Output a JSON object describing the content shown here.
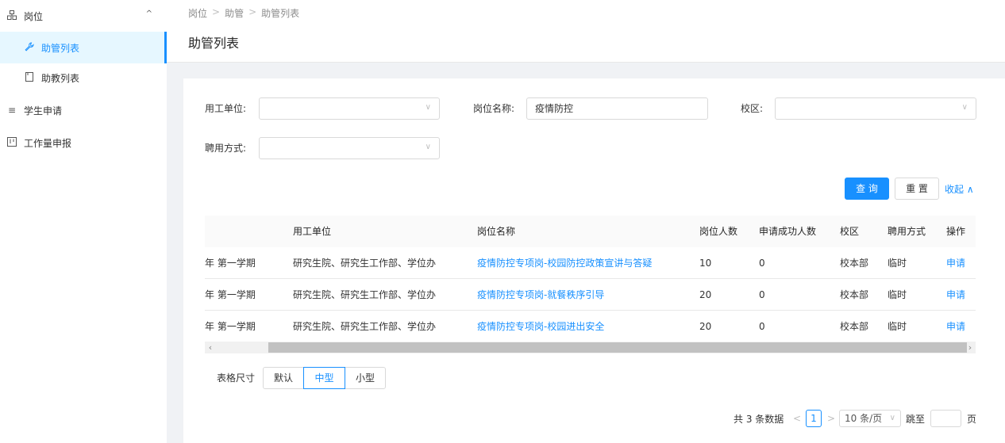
{
  "sidebar": {
    "items": [
      {
        "label": "岗位",
        "icon": "grid-icon",
        "expanded": true
      },
      {
        "label": "助管列表",
        "icon": "wrench-icon",
        "active": true
      },
      {
        "label": "助教列表",
        "icon": "document-icon"
      },
      {
        "label": "学生申请",
        "icon": "list-icon"
      },
      {
        "label": "工作量申报",
        "icon": "board-icon"
      }
    ]
  },
  "header": {
    "breadcrumb": [
      "岗位",
      "助管",
      "助管列表"
    ],
    "breadcrumb_sep": ">",
    "title": "助管列表"
  },
  "filters": {
    "unit_label": "用工单位:",
    "unit_value": "",
    "position_label": "岗位名称:",
    "position_value": "疫情防控",
    "campus_label": "校区:",
    "campus_value": "",
    "hire_label": "聘用方式:",
    "hire_value": ""
  },
  "actions": {
    "query": "查 询",
    "reset": "重 置",
    "collapse": "收起 ∧"
  },
  "table": {
    "columns": [
      "用工单位",
      "岗位名称",
      "岗位人数",
      "申请成功人数",
      "校区",
      "聘用方式",
      "操作"
    ],
    "rows": [
      {
        "term": "年 第一学期",
        "unit": "研究生院、研究生工作部、学位办",
        "position": "疫情防控专项岗-校园防控政策宣讲与答疑",
        "count": "10",
        "success": "0",
        "campus": "校本部",
        "hire": "临时",
        "action": "申请"
      },
      {
        "term": "年 第一学期",
        "unit": "研究生院、研究生工作部、学位办",
        "position": "疫情防控专项岗-就餐秩序引导",
        "count": "20",
        "success": "0",
        "campus": "校本部",
        "hire": "临时",
        "action": "申请"
      },
      {
        "term": "年 第一学期",
        "unit": "研究生院、研究生工作部、学位办",
        "position": "疫情防控专项岗-校园进出安全",
        "count": "20",
        "success": "0",
        "campus": "校本部",
        "hire": "临时",
        "action": "申请"
      }
    ]
  },
  "table_size": {
    "label": "表格尺寸",
    "options": [
      "默认",
      "中型",
      "小型"
    ],
    "selected": "中型"
  },
  "pagination": {
    "total": "共 3 条数据",
    "current_page": "1",
    "page_size": "10 条/页",
    "jump_label": "跳至",
    "page_suffix": "页"
  },
  "colors": {
    "accent": "#1890ff"
  }
}
